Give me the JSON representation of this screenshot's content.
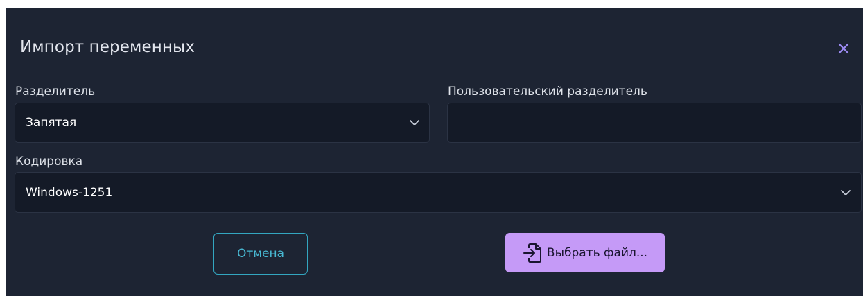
{
  "dialog": {
    "title": "Импорт переменных",
    "close_icon": "close-icon"
  },
  "separator": {
    "label": "Разделитель",
    "value": "Запятая"
  },
  "custom_separator": {
    "label": "Пользовательский разделитель",
    "value": ""
  },
  "encoding": {
    "label": "Кодировка",
    "value": "Windows-1251"
  },
  "buttons": {
    "cancel_label": "Отмена",
    "choose_file_label": "Выбрать файл...",
    "choose_file_icon": "file-import-icon"
  },
  "colors": {
    "dialog_bg": "#1d2433",
    "field_bg": "#141a27",
    "accent_purple": "#c59af7",
    "accent_cyan": "#33a6c0",
    "close_icon": "#9d8cf5"
  }
}
